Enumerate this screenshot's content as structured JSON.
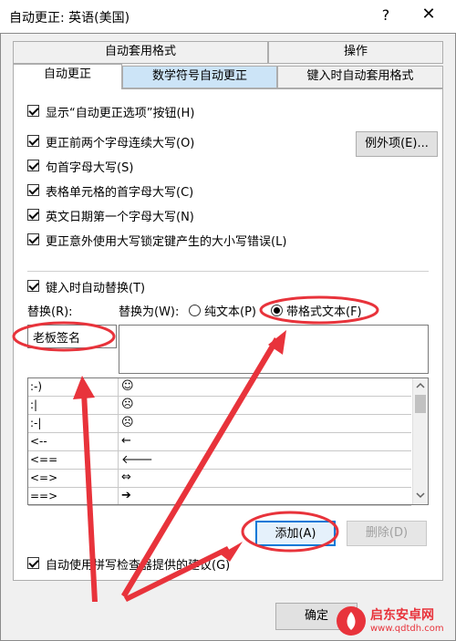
{
  "window": {
    "title": "自动更正: 英语(美国)",
    "help": "?",
    "close": "✕"
  },
  "tabs_back": [
    "自动套用格式",
    "操作"
  ],
  "tabs_front": [
    "自动更正",
    "数学符号自动更正",
    "键入时自动套用格式"
  ],
  "options": {
    "show_buttons": "显示“自动更正选项”按钮(H)",
    "two_caps": "更正前两个字母连续大写(O)",
    "first_letter_sentence": "句首字母大写(S)",
    "first_letter_table": "表格单元格的首字母大写(C)",
    "day_names": "英文日期第一个字母大写(N)",
    "caps_lock": "更正意外使用大写锁定键产生的大小写错误(L)",
    "exceptions_btn": "例外项(E)...",
    "replace_as_type": "键入时自动替换(T)",
    "replace_label": "替换(R):",
    "with_label": "替换为(W):",
    "plain_text": "纯文本(P)",
    "formatted_text": "带格式文本(F)",
    "replace_value": "老板签名",
    "use_spelling": "自动使用拼写检查器提供的建议(G)"
  },
  "list_rows": [
    {
      "from": ":-)",
      "to": "☺"
    },
    {
      "from": ":|",
      "to": "☹"
    },
    {
      "from": ":-|",
      "to": "☹"
    },
    {
      "from": "<--",
      "to": "←"
    },
    {
      "from": "<==",
      "to": "🡐"
    },
    {
      "from": "<=>",
      "to": "⇔"
    },
    {
      "from": "==>",
      "to": "➔"
    }
  ],
  "buttons": {
    "add": "添加(A)",
    "delete": "删除(D)",
    "ok": "确定"
  },
  "watermark": {
    "name": "启东安卓网",
    "url": "www.qdtdh.com"
  },
  "colors": {
    "annotation": "#e8333b",
    "selected_tab": "#cce4f7"
  }
}
